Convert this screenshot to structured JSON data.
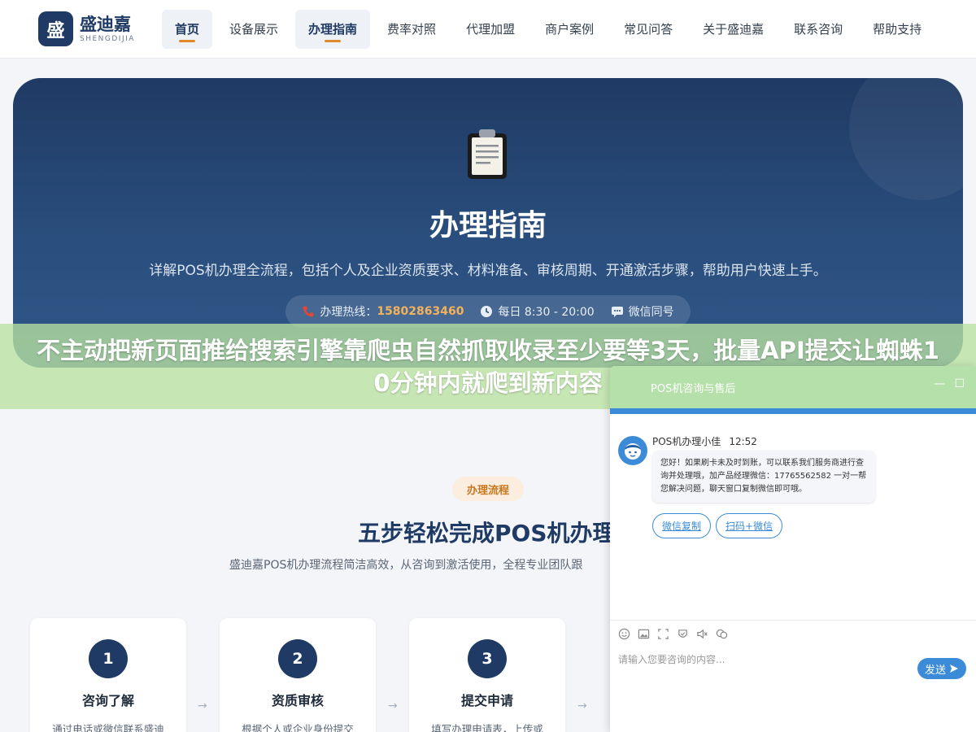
{
  "header": {
    "logo_badge": "盛",
    "logo_cn": "盛迪嘉",
    "logo_en": "SHENGDIJIA",
    "nav": [
      "首页",
      "设备展示",
      "办理指南",
      "费率对照",
      "代理加盟",
      "商户案例",
      "常见问答",
      "关于盛迪嘉",
      "联系咨询",
      "帮助支持"
    ]
  },
  "hero": {
    "title": "办理指南",
    "subtitle": "详解POS机办理全流程，包括个人及企业资质要求、材料准备、审核周期、开通激活步骤，帮助用户快速上手。",
    "hotline_label": "办理热线：",
    "hotline": "15802863460",
    "hours": "每日 8:30 - 20:00",
    "wechat": "微信同号"
  },
  "banner": {
    "text": "不主动把新页面推给搜索引擎靠爬虫自然抓取收录至少要等3天，批量API提交让蜘蛛10分钟内就爬到新内容"
  },
  "process": {
    "tag": "办理流程",
    "title": "五步轻松完成POS机办理",
    "subtitle": "盛迪嘉POS机办理流程简洁高效，从咨询到激活使用，全程专业团队跟",
    "steps": [
      {
        "num": "1",
        "title": "咨询了解",
        "desc": "通过电话或微信联系盛迪"
      },
      {
        "num": "2",
        "title": "资质审核",
        "desc": "根据个人或企业身份提交"
      },
      {
        "num": "3",
        "title": "提交申请",
        "desc": "填写办理申请表，上传或"
      }
    ]
  },
  "chat": {
    "title": "POS机咨询与售后",
    "min": "—",
    "max": "☐",
    "agent": "POS机办理小佳",
    "time": "12:52",
    "message": "您好！如果刷卡未及时到账，可以联系我们服务商进行查询并处理哦，加产品经理微信：17765562582 一对一帮您解决问题，聊天窗口复制微信即可哦。",
    "chips": [
      "微信复制",
      "扫码+微信"
    ],
    "placeholder": "请输入您要咨询的内容...",
    "send": "发送"
  },
  "colors": {
    "primary": "#1f3a64",
    "accent": "#e0892a",
    "chat_blue": "#3b8bd9",
    "banner_green": "#b8e2a0"
  }
}
